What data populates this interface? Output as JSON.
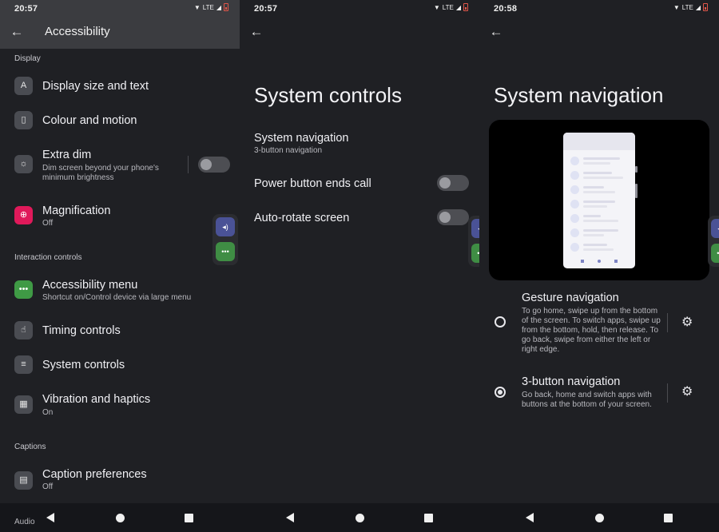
{
  "panel1": {
    "status_time": "20:57",
    "lte": "LTE",
    "title": "Accessibility",
    "sections": {
      "display": "Display",
      "interaction": "Interaction controls",
      "captions": "Captions",
      "audio": "Audio"
    },
    "items": [
      {
        "label": "Display size and text",
        "icon": "text-size-icon"
      },
      {
        "label": "Colour and motion",
        "icon": "phone-color-icon"
      },
      {
        "label": "Extra dim",
        "sub": "Dim screen beyond your phone's",
        "sub2": "minimum brightness",
        "icon": "dim-icon"
      },
      {
        "label": "Magnification",
        "sub": "Off",
        "icon": "magnify-icon"
      },
      {
        "label": "Accessibility menu",
        "sub": "Shortcut on/Control device via large menu",
        "icon": "menu-dots-icon"
      },
      {
        "label": "Timing controls",
        "icon": "touch-icon"
      },
      {
        "label": "System controls",
        "icon": "sliders-icon"
      },
      {
        "label": "Vibration and haptics",
        "sub": "On",
        "icon": "vibration-icon"
      },
      {
        "label": "Caption preferences",
        "sub": "Off",
        "icon": "caption-icon"
      }
    ],
    "extra_dim_enabled": false
  },
  "panel2": {
    "status_time": "20:57",
    "lte": "LTE",
    "title": "System controls",
    "items": [
      {
        "label": "System navigation",
        "sub": "3-button navigation"
      },
      {
        "label": "Power button ends call",
        "enabled": false
      },
      {
        "label": "Auto-rotate screen",
        "enabled": false
      }
    ]
  },
  "panel3": {
    "status_time": "20:58",
    "lte": "LTE",
    "title": "System navigation",
    "options": [
      {
        "title": "Gesture navigation",
        "desc": "To go home, swipe up from the bottom of the screen. To switch apps, swipe up from the bottom, hold, then release. To go back, swipe from either the left or right edge.",
        "selected": false
      },
      {
        "title": "3-button navigation",
        "desc": "Go back, home and switch apps with buttons at the bottom of your screen.",
        "selected": true
      }
    ]
  },
  "floating_menu": {
    "volume_icon": "◂)",
    "more_icon": "•••"
  },
  "colors": {
    "background": "#1f2024",
    "header": "#3b3c40",
    "accent_pink": "#e0195a",
    "accent_green": "#3f9a45",
    "accent_blue": "#4a5296"
  }
}
